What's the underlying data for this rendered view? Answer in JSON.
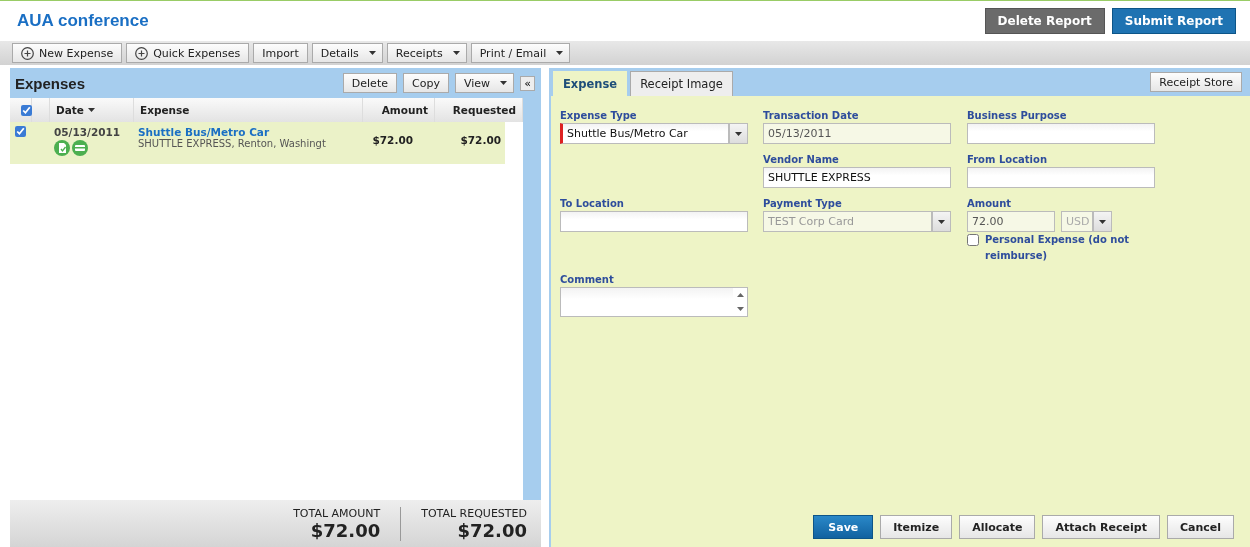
{
  "report": {
    "title": "AUA conference",
    "actions": [
      {
        "label": "Delete Report",
        "kind": "secondary"
      },
      {
        "label": "Submit Report",
        "kind": "primary"
      }
    ]
  },
  "toolbar": [
    {
      "label": "New Expense",
      "kind": "add"
    },
    {
      "label": "Quick Expenses",
      "kind": "add"
    },
    {
      "label": "Import",
      "kind": "plain"
    },
    {
      "label": "Details",
      "kind": "menu"
    },
    {
      "label": "Receipts",
      "kind": "menu"
    },
    {
      "label": "Print / Email",
      "kind": "menu"
    }
  ],
  "expenses": {
    "title": "Expenses",
    "buttons": [
      {
        "label": "Delete",
        "kind": "plain"
      },
      {
        "label": "Copy",
        "kind": "plain"
      },
      {
        "label": "View",
        "kind": "menu"
      }
    ],
    "collapse": "«",
    "all_checked": true,
    "columns": [
      "Date",
      "Expense",
      "Amount",
      "Requested"
    ],
    "rows": [
      {
        "checked": true,
        "selected": true,
        "date": "05/13/2011",
        "expense": "Shuttle Bus/Metro Car",
        "vendor": "SHUTTLE EXPRESS, Renton, Washingt",
        "amount": "$72.00",
        "requested": "$72.00"
      }
    ],
    "totals": [
      {
        "label": "TOTAL AMOUNT",
        "value": "$72.00"
      },
      {
        "label": "TOTAL REQUESTED",
        "value": "$72.00"
      }
    ]
  },
  "detail": {
    "tabs": [
      {
        "label": "Expense",
        "selected": true
      },
      {
        "label": "Receipt Image",
        "selected": false
      }
    ],
    "receipt_store": "Receipt Store",
    "form_rows": [
      [
        {
          "kind": "select",
          "label": "Expense Type",
          "value": "Shuttle Bus/Metro Car",
          "required": true
        },
        {
          "kind": "text",
          "label": "Transaction Date",
          "value": "05/13/2011",
          "disabled": true
        },
        {
          "kind": "text",
          "label": "Business Purpose"
        }
      ],
      [
        null,
        {
          "kind": "text",
          "label": "Vendor Name",
          "value": "SHUTTLE EXPRESS"
        },
        {
          "kind": "text",
          "label": "From Location"
        }
      ],
      [
        {
          "kind": "text",
          "label": "To Location"
        },
        {
          "kind": "select",
          "label": "Payment Type",
          "value": "TEST Corp Card",
          "required": false,
          "disabled": true
        },
        {
          "kind": "amount",
          "label": "Amount",
          "value": "72.00",
          "currency": "USD",
          "disabled": true
        }
      ],
      [
        null,
        null,
        {
          "kind": "checkbox",
          "label": "Personal Expense (do not reimburse)",
          "checked": false
        }
      ],
      [
        {
          "kind": "textarea",
          "label": "Comment"
        }
      ]
    ],
    "buttons": [
      {
        "label": "Save",
        "kind": "primary"
      },
      {
        "label": "Itemize",
        "kind": "plain"
      },
      {
        "label": "Allocate",
        "kind": "plain"
      },
      {
        "label": "Attach Receipt",
        "kind": "plain"
      },
      {
        "label": "Cancel",
        "kind": "plain"
      }
    ]
  }
}
